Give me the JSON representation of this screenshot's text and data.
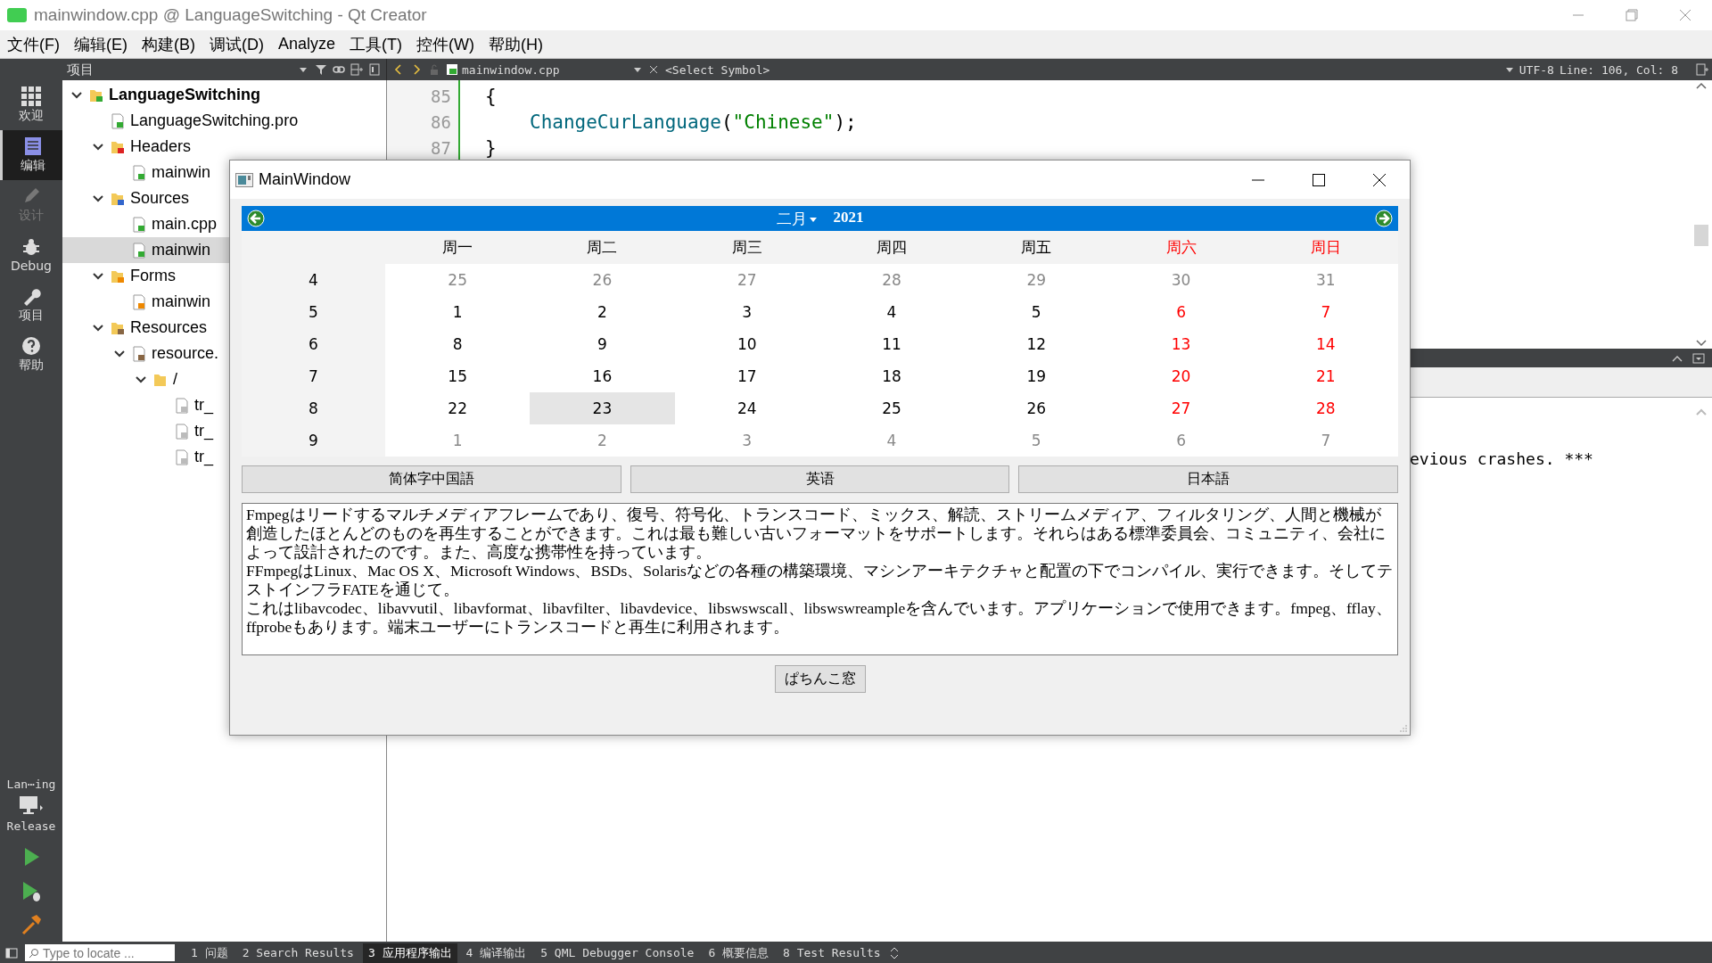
{
  "window": {
    "title": "mainwindow.cpp @ LanguageSwitching - Qt Creator"
  },
  "menu": [
    "文件(F)",
    "编辑(E)",
    "构建(B)",
    "调试(D)",
    "Analyze",
    "工具(T)",
    "控件(W)",
    "帮助(H)"
  ],
  "modes": [
    {
      "label": "欢迎",
      "kind": "welcome",
      "selected": false,
      "disabled": false
    },
    {
      "label": "编辑",
      "kind": "edit",
      "selected": true,
      "disabled": false
    },
    {
      "label": "设计",
      "kind": "design",
      "selected": false,
      "disabled": true
    },
    {
      "label": "Debug",
      "kind": "debug",
      "selected": false,
      "disabled": false
    },
    {
      "label": "项目",
      "kind": "projects",
      "selected": false,
      "disabled": false
    },
    {
      "label": "帮助",
      "kind": "help",
      "selected": false,
      "disabled": false
    }
  ],
  "kit": {
    "project": "Lan⋯ing",
    "config": "Release"
  },
  "project_pane": {
    "title": "项目",
    "tree": [
      {
        "label": "LanguageSwitching",
        "kind": "project",
        "expanded": true,
        "selected": false,
        "children": [
          {
            "label": "LanguageSwitching.pro",
            "kind": "pro",
            "selected": false
          },
          {
            "label": "Headers",
            "kind": "headers",
            "expanded": true,
            "selected": false,
            "children": [
              {
                "label": "mainwin",
                "kind": "source",
                "selected": false
              }
            ]
          },
          {
            "label": "Sources",
            "kind": "sources",
            "expanded": true,
            "selected": false,
            "children": [
              {
                "label": "main.cpp",
                "kind": "source",
                "selected": false
              },
              {
                "label": "mainwin",
                "kind": "source",
                "selected": true
              }
            ]
          },
          {
            "label": "Forms",
            "kind": "forms",
            "expanded": true,
            "selected": false,
            "children": [
              {
                "label": "mainwin",
                "kind": "form",
                "selected": false
              }
            ]
          },
          {
            "label": "Resources",
            "kind": "resources",
            "expanded": true,
            "selected": false,
            "children": [
              {
                "label": "resource.",
                "kind": "qrc",
                "expanded": true,
                "selected": false,
                "children": [
                  {
                    "label": "/",
                    "kind": "prefix",
                    "expanded": true,
                    "selected": false,
                    "children": [
                      {
                        "label": "tr_",
                        "kind": "file",
                        "selected": false
                      },
                      {
                        "label": "tr_",
                        "kind": "file",
                        "selected": false
                      },
                      {
                        "label": "tr_",
                        "kind": "file",
                        "selected": false
                      }
                    ]
                  }
                ]
              }
            ]
          }
        ]
      }
    ]
  },
  "editor": {
    "file": "mainwindow.cpp",
    "symbol": "<Select Symbol>",
    "encoding": "UTF-8",
    "position": "Line: 106, Col: 8",
    "lines": [
      {
        "number": "85",
        "indented": false,
        "tokens": [
          {
            "text": "{",
            "kind": "plain"
          }
        ]
      },
      {
        "number": "86",
        "indented": true,
        "tokens": [
          {
            "text": "ChangeCurLanguage",
            "kind": "function"
          },
          {
            "text": "(",
            "kind": "plain"
          },
          {
            "text": "\"Chinese\"",
            "kind": "string"
          },
          {
            "text": ");",
            "kind": "plain"
          }
        ]
      },
      {
        "number": "87",
        "indented": false,
        "tokens": [
          {
            "text": "}",
            "kind": "plain"
          }
        ]
      }
    ]
  },
  "output": {
    "text": "evious crashes. ***"
  },
  "status_bar": {
    "locate_placeholder": "Type to locate ...",
    "panes": [
      {
        "label": "1 问题",
        "selected": false
      },
      {
        "label": "2 Search Results",
        "selected": false
      },
      {
        "label": "3 应用程序输出",
        "selected": true
      },
      {
        "label": "4 编译输出",
        "selected": false
      },
      {
        "label": "5 QML Debugger Console",
        "selected": false
      },
      {
        "label": "6 概要信息",
        "selected": false
      },
      {
        "label": "8 Test Results",
        "selected": false
      }
    ]
  },
  "dialog": {
    "title": "MainWindow",
    "calendar": {
      "month": "二月",
      "year": "2021",
      "day_headers": [
        {
          "label": "周一",
          "weekend": false
        },
        {
          "label": "周二",
          "weekend": false
        },
        {
          "label": "周三",
          "weekend": false
        },
        {
          "label": "周四",
          "weekend": false
        },
        {
          "label": "周五",
          "weekend": false
        },
        {
          "label": "周六",
          "weekend": true
        },
        {
          "label": "周日",
          "weekend": true
        }
      ],
      "weeks": [
        {
          "number": "4",
          "days": [
            {
              "day": "25",
              "other_month": true,
              "selected": false
            },
            {
              "day": "26",
              "other_month": true,
              "selected": false
            },
            {
              "day": "27",
              "other_month": true,
              "selected": false
            },
            {
              "day": "28",
              "other_month": true,
              "selected": false
            },
            {
              "day": "29",
              "other_month": true,
              "selected": false
            },
            {
              "day": "30",
              "other_month": true,
              "selected": false
            },
            {
              "day": "31",
              "other_month": true,
              "selected": false
            }
          ]
        },
        {
          "number": "5",
          "days": [
            {
              "day": "1",
              "other_month": false,
              "selected": false
            },
            {
              "day": "2",
              "other_month": false,
              "selected": false
            },
            {
              "day": "3",
              "other_month": false,
              "selected": false
            },
            {
              "day": "4",
              "other_month": false,
              "selected": false
            },
            {
              "day": "5",
              "other_month": false,
              "selected": false
            },
            {
              "day": "6",
              "other_month": false,
              "selected": false
            },
            {
              "day": "7",
              "other_month": false,
              "selected": false
            }
          ]
        },
        {
          "number": "6",
          "days": [
            {
              "day": "8",
              "other_month": false,
              "selected": false
            },
            {
              "day": "9",
              "other_month": false,
              "selected": false
            },
            {
              "day": "10",
              "other_month": false,
              "selected": false
            },
            {
              "day": "11",
              "other_month": false,
              "selected": false
            },
            {
              "day": "12",
              "other_month": false,
              "selected": false
            },
            {
              "day": "13",
              "other_month": false,
              "selected": false
            },
            {
              "day": "14",
              "other_month": false,
              "selected": false
            }
          ]
        },
        {
          "number": "7",
          "days": [
            {
              "day": "15",
              "other_month": false,
              "selected": false
            },
            {
              "day": "16",
              "other_month": false,
              "selected": false
            },
            {
              "day": "17",
              "other_month": false,
              "selected": false
            },
            {
              "day": "18",
              "other_month": false,
              "selected": false
            },
            {
              "day": "19",
              "other_month": false,
              "selected": false
            },
            {
              "day": "20",
              "other_month": false,
              "selected": false
            },
            {
              "day": "21",
              "other_month": false,
              "selected": false
            }
          ]
        },
        {
          "number": "8",
          "days": [
            {
              "day": "22",
              "other_month": false,
              "selected": false
            },
            {
              "day": "23",
              "other_month": false,
              "selected": true
            },
            {
              "day": "24",
              "other_month": false,
              "selected": false
            },
            {
              "day": "25",
              "other_month": false,
              "selected": false
            },
            {
              "day": "26",
              "other_month": false,
              "selected": false
            },
            {
              "day": "27",
              "other_month": false,
              "selected": false
            },
            {
              "day": "28",
              "other_month": false,
              "selected": false
            }
          ]
        },
        {
          "number": "9",
          "days": [
            {
              "day": "1",
              "other_month": true,
              "selected": false
            },
            {
              "day": "2",
              "other_month": true,
              "selected": false
            },
            {
              "day": "3",
              "other_month": true,
              "selected": false
            },
            {
              "day": "4",
              "other_month": true,
              "selected": false
            },
            {
              "day": "5",
              "other_month": true,
              "selected": false
            },
            {
              "day": "6",
              "other_month": true,
              "selected": false
            },
            {
              "day": "7",
              "other_month": true,
              "selected": false
            }
          ]
        }
      ]
    },
    "language_buttons": [
      "简体字中国語",
      "英语",
      "日本語"
    ],
    "text": [
      "Fmpegはリードするマルチメディアフレームであり、復号、符号化、トランスコード、ミックス、解読、ストリームメディア、フィルタリング、人間と機械が創造したほとんどのものを再生することができます。これは最も難しい古いフォーマットをサポートします。それらはある標準委員会、コミュニティ、会社によって設計されたのです。また、高度な携帯性を持っています。",
      "FFmpegはLinux、Mac OS X、Microsoft Windows、BSDs、Solarisなどの各種の構築環境、マシンアーキテクチャと配置の下でコンパイル、実行できます。そしてテストインフラFATEを通じて。",
      "これはlibavcodec、libavvutil、libavformat、libavfilter、libavdevice、libswswscall、libswswreampleを含んでいます。アプリケーションで使用できます。fmpeg、fflay、ffprobeもあります。端末ユーザーにトランスコードと再生に利用されます。"
    ],
    "popup_button": "ぱちんこ窓"
  }
}
